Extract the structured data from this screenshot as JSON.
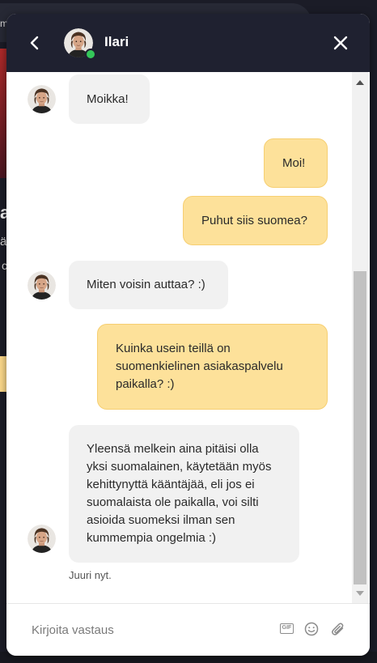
{
  "background": {
    "tab_text": "m",
    "big_text": "a",
    "line1": "ä",
    "line2": "c"
  },
  "header": {
    "agent_name": "Ilari",
    "status": "online"
  },
  "messages": [
    {
      "from": "agent",
      "text": "Moikka!"
    },
    {
      "from": "user",
      "text": "Moi!"
    },
    {
      "from": "user",
      "text": "Puhut siis suomea?"
    },
    {
      "from": "agent",
      "text": "Miten voisin auttaa? :)"
    },
    {
      "from": "user",
      "text": "Kuinka usein teillä on\nsuomenkielinen asiakaspalvelu\npaikalla? :)"
    },
    {
      "from": "agent",
      "text": "Yleensä melkein aina pitäisi olla\nyksi suomalainen, käytetään myös\nkehittynyttä kääntäjää, eli jos ei\nsuomalaista ole paikalla, voi silti\nasioida suomeksi ilman sen\nkummempia ongelmia :)"
    }
  ],
  "last_message_time": "Juuri nyt.",
  "composer": {
    "placeholder": "Kirjoita vastaus",
    "gif_label": "GIF"
  },
  "colors": {
    "header_bg": "#1f2130",
    "user_bubble": "#fde19a",
    "agent_bubble": "#f1f1f1",
    "online": "#34c759"
  },
  "icons": [
    "back-arrow-icon",
    "close-icon",
    "gif-icon",
    "emoji-icon",
    "paperclip-icon"
  ]
}
